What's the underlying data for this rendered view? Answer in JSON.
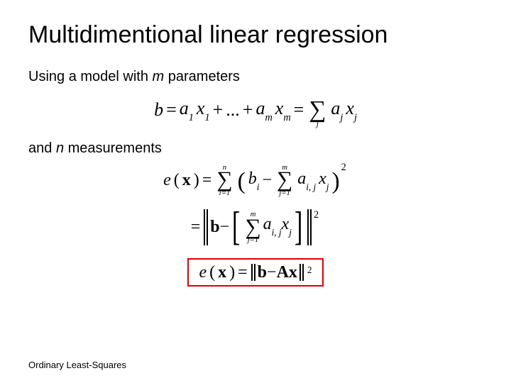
{
  "title": "Multidimentional linear regression",
  "line1_a": "Using a model with ",
  "line1_m": "m",
  "line1_b": " parameters",
  "line2_a": "and ",
  "line2_n": "n",
  "line2_b": " measurements",
  "footer": "Ordinary Least-Squares",
  "eq1": {
    "b": "b",
    "eq": " = ",
    "a": "a",
    "one": "1",
    "x": "x",
    "plus": " + ",
    "dots": "...",
    "m": "m",
    "sumj": "j",
    "j": "j"
  },
  "eq2": {
    "e": "e",
    "x": "x",
    "eq": " = ",
    "n": "n",
    "i1": "i=1",
    "b": "b",
    "i": "i",
    "minus": " − ",
    "m": "m",
    "j1": "j=1",
    "a": "a",
    "ij": "i, j",
    "j": "j",
    "sq": "2"
  },
  "eq3": {
    "eq": "= ",
    "bold_b": "b",
    "minus": " − ",
    "m": "m",
    "j1": "j=1",
    "a": "a",
    "ij": "i, j",
    "x": "x",
    "j": "j",
    "sq": "2"
  },
  "eq4": {
    "e": "e",
    "x": "x",
    "eq": " = ",
    "bold_b": "b",
    "minus": " − ",
    "A": "A",
    "xv": "x",
    "sq": "2"
  }
}
